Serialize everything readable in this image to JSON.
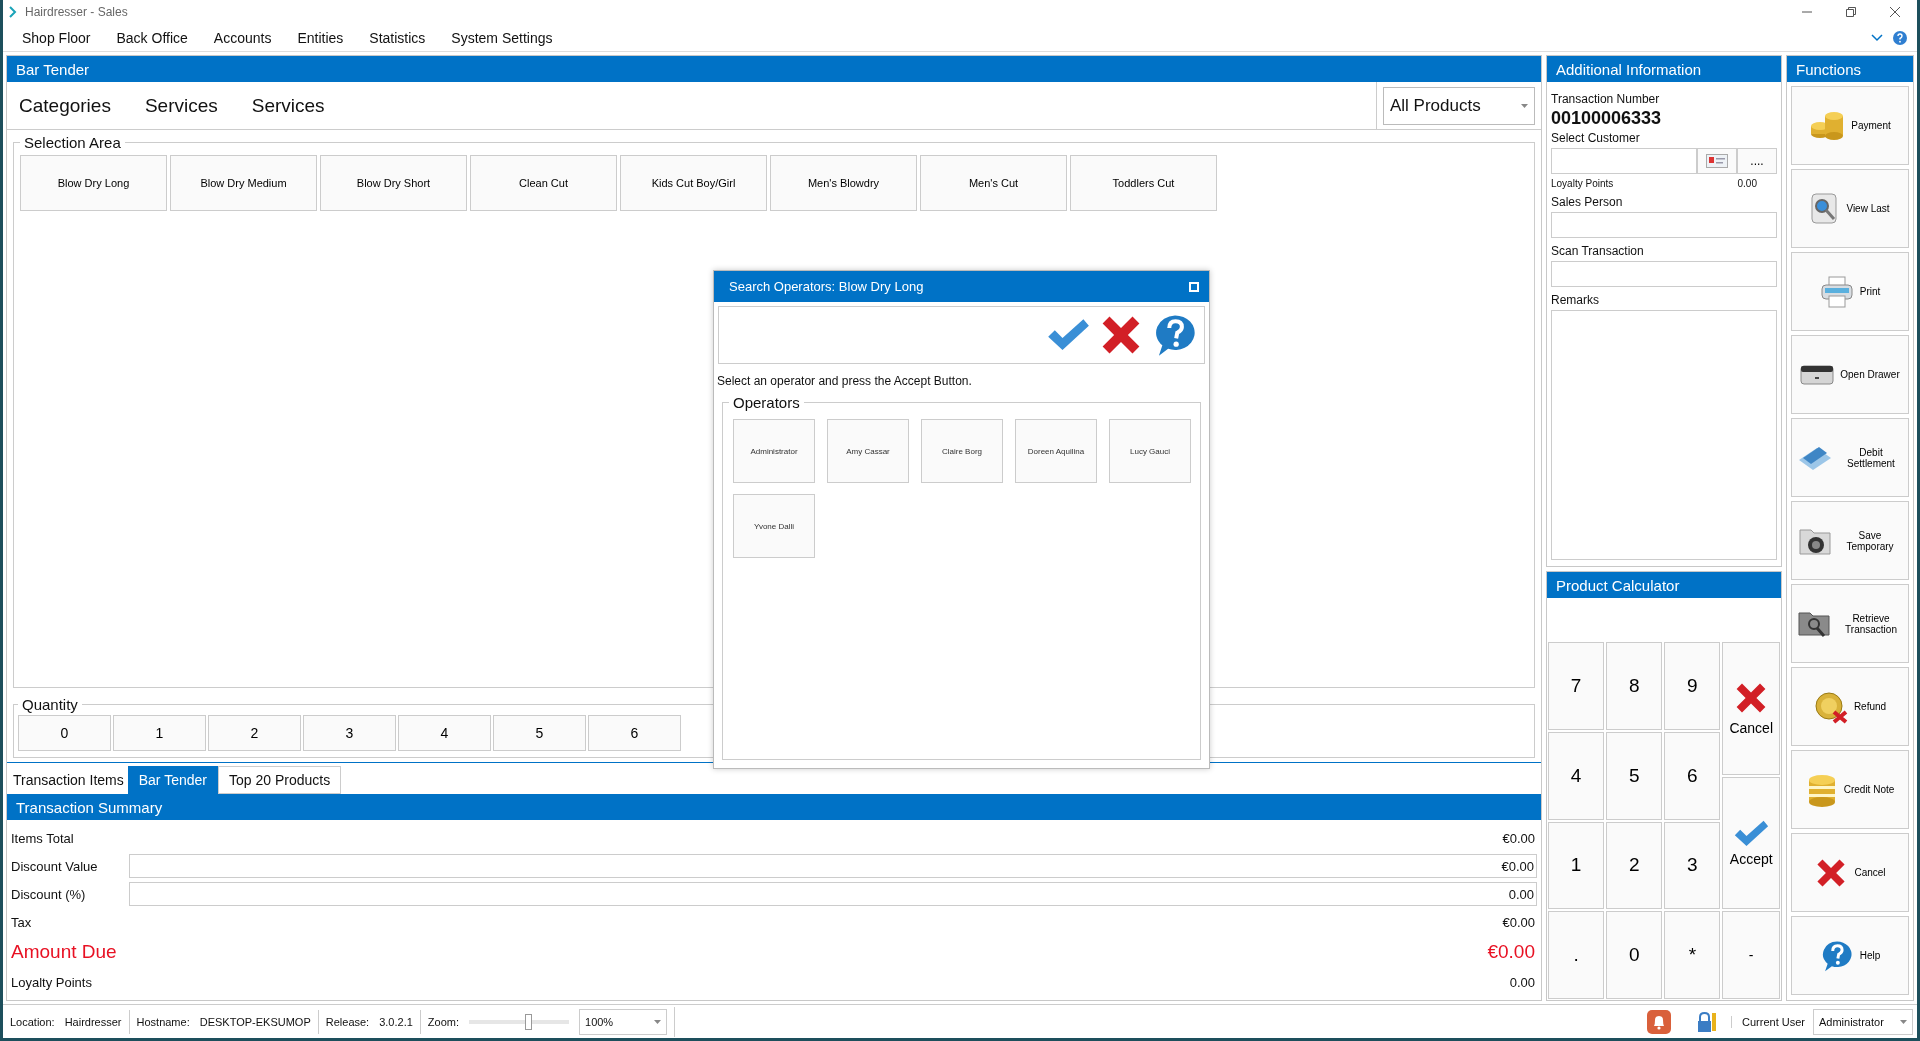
{
  "window": {
    "title": "Hairdresser - Sales"
  },
  "menu": [
    "Shop Floor",
    "Back Office",
    "Accounts",
    "Entities",
    "Statistics",
    "System Settings"
  ],
  "main_panel": {
    "title": "Bar Tender",
    "breadcrumbs": [
      "Categories",
      "Services",
      "Services"
    ],
    "product_filter": {
      "value": "All Products"
    },
    "selection_area": {
      "title": "Selection Area",
      "items": [
        "Blow Dry Long",
        "Blow Dry Medium",
        "Blow Dry Short",
        "Clean Cut",
        "Kids Cut Boy/Girl",
        "Men's Blowdry",
        "Men's Cut",
        "Toddlers Cut"
      ]
    },
    "quantity": {
      "title": "Quantity",
      "keys": [
        "0",
        "1",
        "2",
        "3",
        "4",
        "5",
        "6"
      ]
    }
  },
  "bottom_tabs": [
    {
      "label": "Transaction Items",
      "selected": false
    },
    {
      "label": "Bar Tender",
      "selected": true
    },
    {
      "label": "Top 20 Products",
      "selected": false
    }
  ],
  "transaction_summary": {
    "title": "Transaction Summary",
    "rows": [
      {
        "kind": "text",
        "label": "Items Total",
        "value": "€0.00"
      },
      {
        "kind": "field",
        "label": "Discount Value",
        "value": "€0.00"
      },
      {
        "kind": "field",
        "label": "Discount (%)",
        "value": "0.00"
      },
      {
        "kind": "text",
        "label": "Tax",
        "value": "€0.00"
      },
      {
        "kind": "total",
        "label": "Amount Due",
        "value": "€0.00"
      },
      {
        "kind": "text",
        "label": "Loyalty Points",
        "value": "0.00"
      }
    ]
  },
  "additional_information": {
    "title": "Additional Information",
    "transaction_number_label": "Transaction Number",
    "transaction_number": "00100006333",
    "select_customer_label": "Select Customer",
    "browse_button": "....",
    "loyalty_points_label": "Loyalty Points",
    "loyalty_points": "0.00",
    "sales_person_label": "Sales Person",
    "scan_transaction_label": "Scan Transaction",
    "remarks_label": "Remarks"
  },
  "product_calculator": {
    "title": "Product Calculator",
    "keys": [
      {
        "kind": "digit",
        "label": "7"
      },
      {
        "kind": "digit",
        "label": "8"
      },
      {
        "kind": "digit",
        "label": "9"
      },
      {
        "kind": "digit",
        "label": "4"
      },
      {
        "kind": "digit",
        "label": "5"
      },
      {
        "kind": "digit",
        "label": "6"
      },
      {
        "kind": "digit",
        "label": "1"
      },
      {
        "kind": "digit",
        "label": "2"
      },
      {
        "kind": "digit",
        "label": "3"
      },
      {
        "kind": "digit",
        "label": "."
      },
      {
        "kind": "digit",
        "label": "0"
      },
      {
        "kind": "digit",
        "label": "*"
      },
      {
        "kind": "cancel",
        "label": "Cancel"
      },
      {
        "kind": "accept",
        "label": "Accept"
      },
      {
        "kind": "side",
        "label": "-"
      }
    ]
  },
  "functions": {
    "title": "Functions",
    "items": [
      {
        "kind": "payment",
        "label": "Payment"
      },
      {
        "kind": "view",
        "label": "View Last"
      },
      {
        "kind": "print",
        "label": "Print"
      },
      {
        "kind": "drawer",
        "label": "Open Drawer"
      },
      {
        "kind": "settlement",
        "label": "Debit Settlement"
      },
      {
        "kind": "save",
        "label": "Save Temporary"
      },
      {
        "kind": "retrieve",
        "label": "Retrieve Transaction"
      },
      {
        "kind": "refund",
        "label": "Refund"
      },
      {
        "kind": "credit",
        "label": "Credit Note"
      },
      {
        "kind": "cancel",
        "label": "Cancel"
      },
      {
        "kind": "help",
        "label": "Help"
      }
    ]
  },
  "dialog": {
    "title": "Search Operators: Blow Dry Long",
    "instruction": "Select an operator and press the Accept Button.",
    "group_title": "Operators",
    "operators": [
      "Administrator",
      "Amy Cassar",
      "Claire Borg",
      "Doreen Aquilina",
      "Lucy Gauci",
      "Yvone Dalli"
    ]
  },
  "status_bar": {
    "location_label": "Location:",
    "location": "Hairdresser",
    "hostname_label": "Hostname:",
    "hostname": "DESKTOP-EKSUMOP",
    "release_label": "Release:",
    "release": "3.0.2.1",
    "zoom_label": "Zoom:",
    "zoom_slider": {
      "level": 0.6
    },
    "zoom_value": "100%",
    "current_user_label": "Current User",
    "current_user": "Administrator"
  }
}
